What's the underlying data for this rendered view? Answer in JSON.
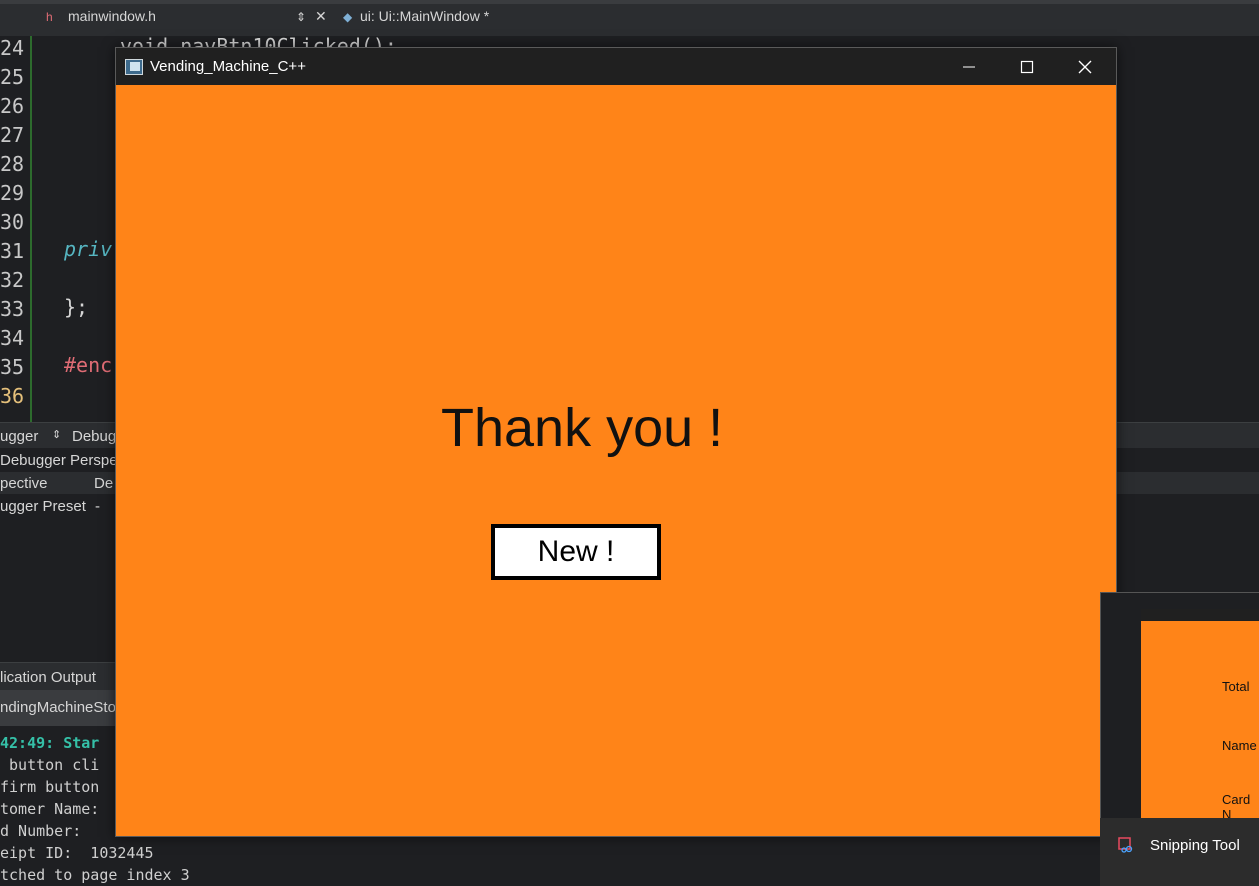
{
  "ide": {
    "tabs": {
      "file": "mainwindow.h",
      "symbol": "ui: Ui::MainWindow *"
    },
    "editor": {
      "line_numbers": [
        "24",
        "25",
        "26",
        "27",
        "28",
        "29",
        "30",
        "31",
        "32",
        "33",
        "34",
        "35",
        "36"
      ],
      "code": {
        "line24": "void navBtn10Clicked();",
        "line31": "priv",
        "line33": "};",
        "line35": "#enc"
      }
    },
    "debugger": {
      "dropdown": "ugger",
      "tab": "Debug",
      "perspective_header": "Debugger Perspect",
      "col_perspective": "pective",
      "col_de": "De",
      "preset": "ugger Preset",
      "preset_dash": "-"
    },
    "output": {
      "title": "lication Output",
      "tab": "ndingMachineSto",
      "lines": [
        "42:49: Star",
        " button cli",
        "firm button",
        "tomer Name:",
        "d Number:  ",
        "eipt ID:  1032445",
        "tched to page index 3"
      ]
    }
  },
  "app": {
    "title": "Vending_Machine_C++",
    "message": "Thank you !",
    "new_button": "New !",
    "colors": {
      "background": "#ff8418",
      "titlebar": "#202020"
    }
  },
  "thumbnail": {
    "labels": [
      "Total",
      "Name",
      "Card N"
    ]
  },
  "taskbar": {
    "snipping_tool": "Snipping Tool"
  }
}
